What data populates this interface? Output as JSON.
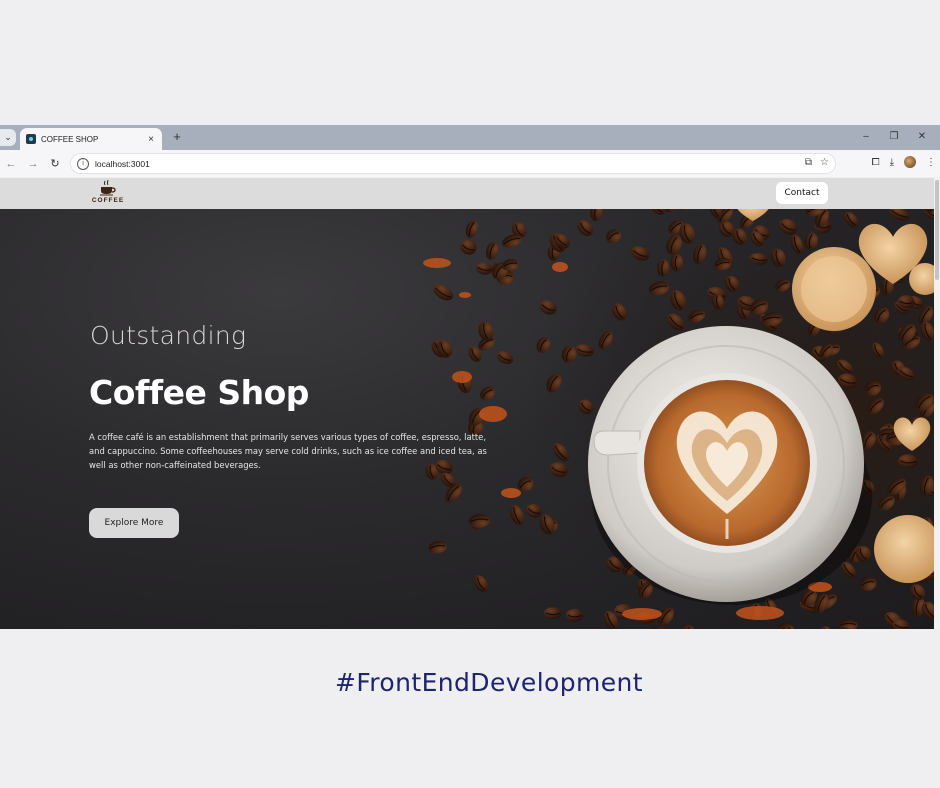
{
  "browser": {
    "tab_title": "COFFEE SHOP",
    "tab_close": "×",
    "new_tab": "+",
    "url": "localhost:3001",
    "window_controls": [
      "–",
      "❐",
      "✕"
    ]
  },
  "site": {
    "logo_text": "COFFEE",
    "nav": {
      "contact_label": "Contact"
    },
    "hero": {
      "subtitle": "Outstanding",
      "title": "Coffee Shop",
      "description": "A coffee café is an establishment that primarily serves various types of coffee, espresso, latte, and cappuccino. Some coffeehouses may serve cold drinks, such as ice coffee and iced tea, as well as other non-caffeinated beverages.",
      "cta_label": "Explore More"
    }
  },
  "caption": "#FrontEndDevelopment",
  "icons": [
    "tab-list-icon",
    "favicon-icon",
    "back-arrow-icon",
    "forward-arrow-icon",
    "reload-icon",
    "site-info-icon",
    "cast-icon",
    "bookmark-star-icon",
    "extensions-icon",
    "download-icon",
    "profile-avatar-icon",
    "menu-kebab-icon",
    "coffee-cup-icon"
  ],
  "colors": {
    "caption": "#1e2470",
    "tabbar": "#a7afbd",
    "navbar": "#dcdcdc",
    "hero_bg": "#2b2a2d"
  }
}
